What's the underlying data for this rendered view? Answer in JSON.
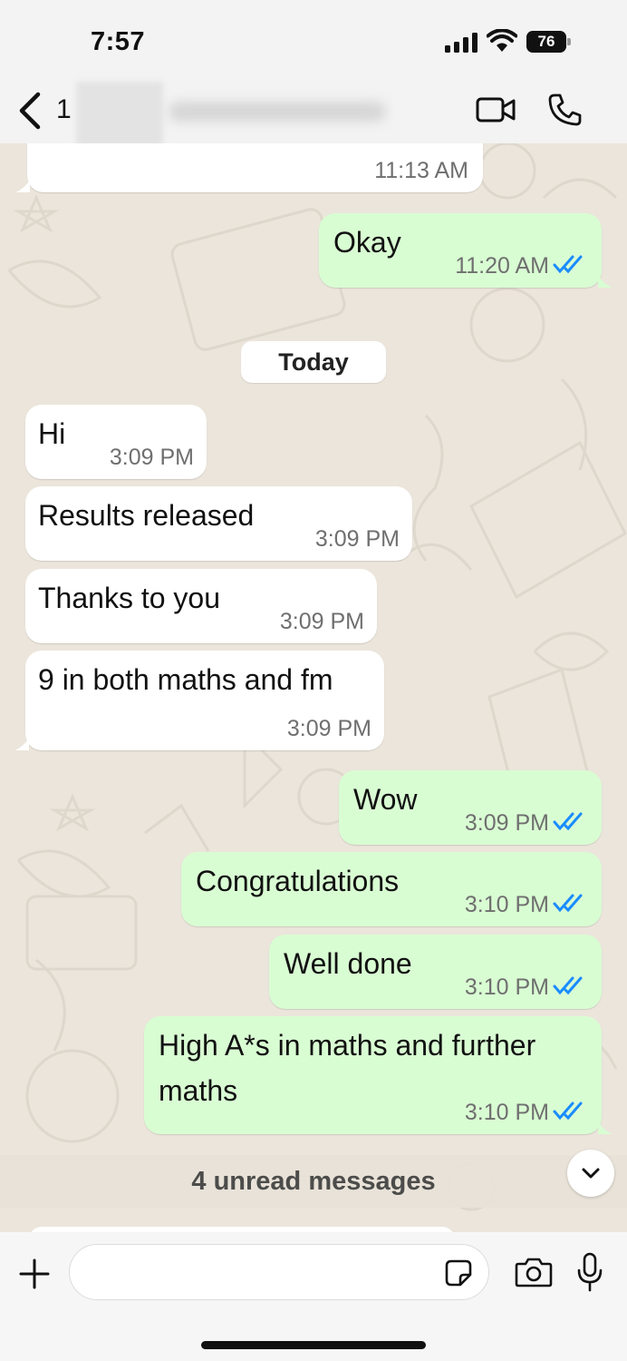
{
  "status_bar": {
    "time": "7:57",
    "battery": "76"
  },
  "header": {
    "contact_name_visible": "1"
  },
  "chat": {
    "date_separator": "Today",
    "messages": [
      {
        "dir": "in",
        "text": "",
        "time": "11:13 AM"
      },
      {
        "dir": "out",
        "text": "Okay",
        "time": "11:20 AM",
        "status": "read"
      },
      {
        "dir": "in",
        "text": "Hi",
        "time": "3:09 PM"
      },
      {
        "dir": "in",
        "text": "Results released",
        "time": "3:09 PM"
      },
      {
        "dir": "in",
        "text": "Thanks to you",
        "time": "3:09 PM"
      },
      {
        "dir": "in",
        "text": "9 in both maths and fm",
        "time": "3:09 PM"
      },
      {
        "dir": "out",
        "text": "Wow",
        "time": "3:09 PM",
        "status": "read"
      },
      {
        "dir": "out",
        "text": "Congratulations",
        "time": "3:10 PM",
        "status": "read"
      },
      {
        "dir": "out",
        "text": "Well done",
        "time": "3:10 PM",
        "status": "read"
      },
      {
        "dir": "out",
        "text_line1": "High A*s in maths and further",
        "text_line2": "maths",
        "time": "3:10 PM",
        "status": "read"
      }
    ],
    "unread_label": "4 unread messages"
  },
  "composer": {
    "value": ""
  },
  "colors": {
    "incoming": "#ffffff",
    "outgoing": "#d9fdd3",
    "tick": "#1a8cff",
    "wallpaper": "#ebe5db"
  },
  "icons": [
    "back-chevron",
    "video-camera",
    "phone",
    "plus",
    "sticker",
    "camera",
    "microphone",
    "chevron-down"
  ]
}
